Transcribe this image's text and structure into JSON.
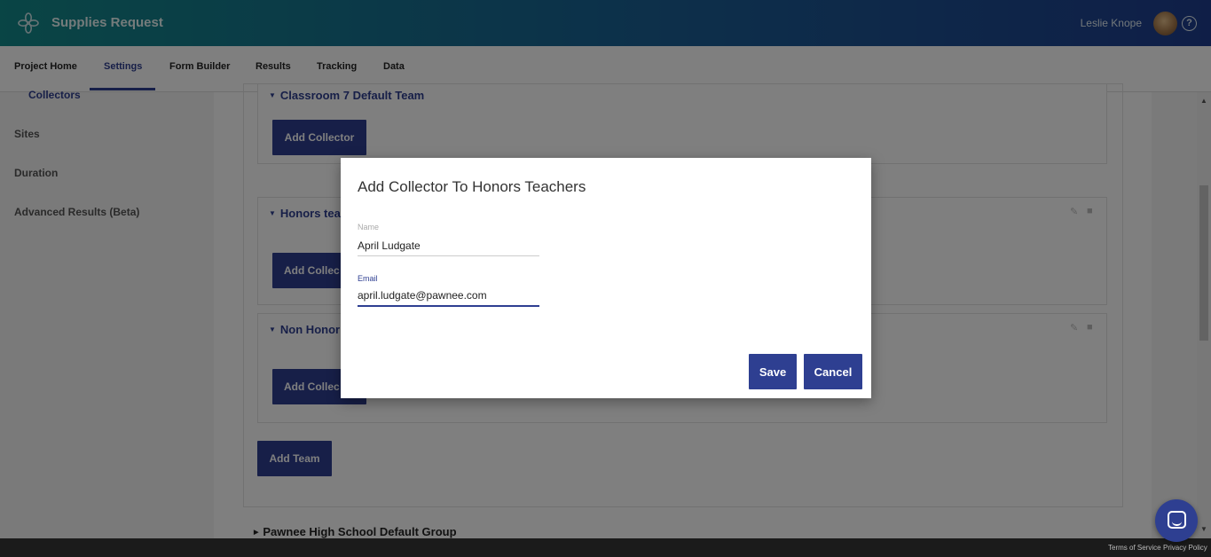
{
  "header": {
    "title": "Supplies Request",
    "user_name": "Leslie Knope",
    "help_glyph": "?"
  },
  "nav": {
    "tabs": [
      "Project Home",
      "Settings",
      "Form Builder",
      "Results",
      "Tracking",
      "Data"
    ],
    "active": "Settings"
  },
  "sidebar": {
    "items": [
      "Collectors",
      "Sites",
      "Duration",
      "Advanced Results (Beta)"
    ]
  },
  "teams": [
    {
      "name": "Classroom 7 Default Team",
      "button": "Add Collector"
    },
    {
      "name": "Honors tea",
      "button": "Add Collec"
    },
    {
      "name": "Non Honor",
      "button": "Add Collec"
    }
  ],
  "add_team_label": "Add Team",
  "group_name": "Pawnee High School Default Group",
  "footer": {
    "terms": "Terms of Service",
    "privacy": "Privacy Policy"
  },
  "modal": {
    "title": "Add Collector To Honors Teachers",
    "name_label": "Name",
    "name_value": "April Ludgate",
    "email_label": "Email",
    "email_value": "april.ludgate@pawnee.com",
    "save_label": "Save",
    "cancel_label": "Cancel"
  },
  "colors": {
    "brand": "#2e3f91",
    "header_start": "#138a8a",
    "header_end": "#1f3d8f"
  },
  "icons": [
    "logo-icon",
    "help-icon",
    "edit-icon",
    "trash-icon",
    "chat-icon",
    "caret-down-icon",
    "caret-right-icon"
  ]
}
